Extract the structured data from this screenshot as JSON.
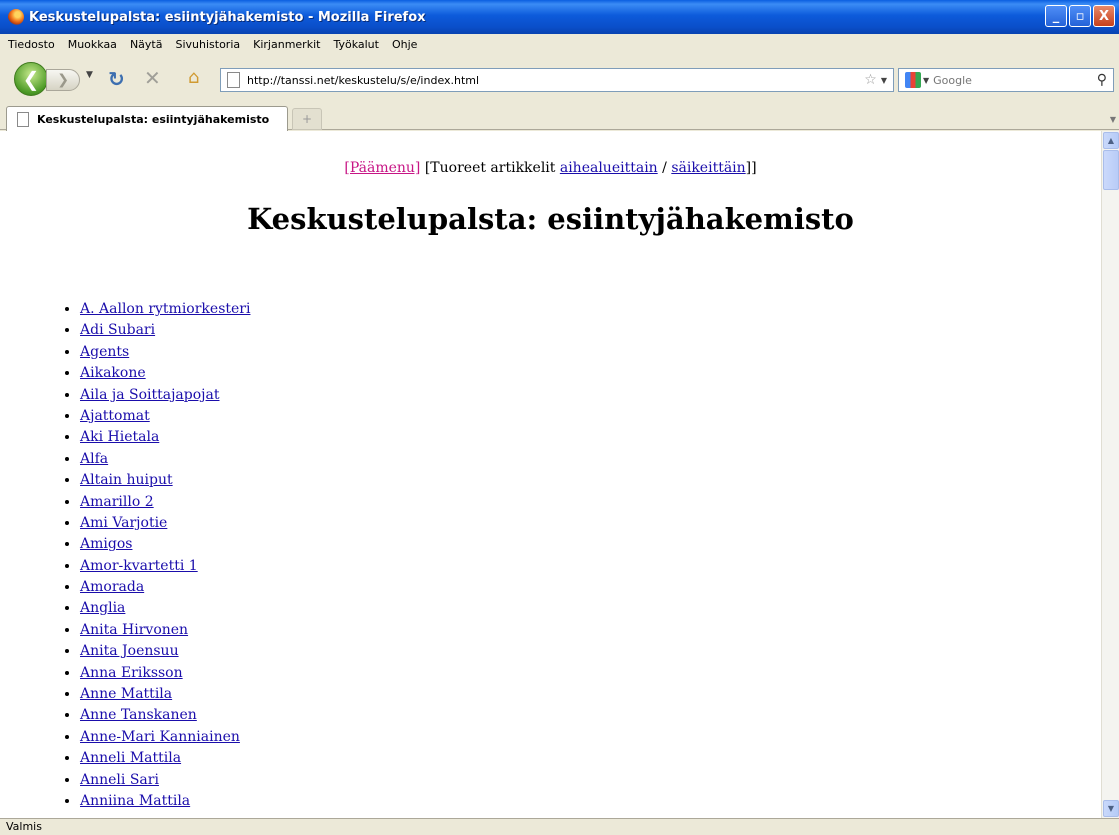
{
  "window": {
    "title": "Keskustelupalsta: esiintyjähakemisto - Mozilla Firefox",
    "controls": [
      "_",
      "▫",
      "X"
    ]
  },
  "menu": [
    "Tiedosto",
    "Muokkaa",
    "Näytä",
    "Sivuhistoria",
    "Kirjanmerkit",
    "Työkalut",
    "Ohje"
  ],
  "toolbar": {
    "url": "http://tanssi.net/keskustelu/s/e/index.html",
    "search_placeholder": "Google"
  },
  "tab": {
    "title": "Keskustelupalsta: esiintyjähakemisto",
    "new_tab_symbol": "+"
  },
  "page": {
    "nav": {
      "main_menu": "[Päämenu]",
      "recent_prefix": "[Tuoreet artikkelit",
      "by_topic": "aihealueittain",
      "separator": "/",
      "by_thread": "säikeittäin",
      "suffix": "]]"
    },
    "heading": "Keskustelupalsta: esiintyjähakemisto",
    "artists": [
      "A. Aallon rytmiorkesteri",
      "Adi Subari",
      "Agents",
      "Aikakone",
      "Aila ja Soittajapojat",
      "Ajattomat",
      "Aki Hietala",
      "Alfa",
      "Altain huiput",
      "Amarillo 2",
      "Ami Varjotie",
      "Amigos",
      "Amor-kvartetti 1",
      "Amorada",
      "Anglia",
      "Anita Hirvonen",
      "Anita Joensuu",
      "Anna Eriksson",
      "Anne Mattila",
      "Anne Tanskanen",
      "Anne-Mari Kanniainen",
      "Anneli Mattila",
      "Anneli Sari",
      "Anniina Mattila"
    ]
  },
  "status": "Valmis"
}
